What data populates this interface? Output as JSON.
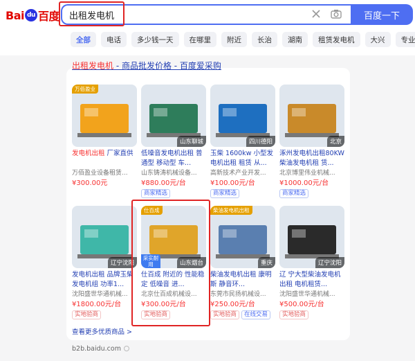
{
  "logo": {
    "bai": "Bai",
    "paw": "du",
    "du": "百度"
  },
  "search": {
    "query": "出租发电机",
    "button_label": "百度一下"
  },
  "chips": [
    "全部",
    "电话",
    "多少钱一天",
    "在哪里",
    "附近",
    "长治",
    "湖南",
    "租赁发电机",
    "大兴",
    "专业"
  ],
  "result": {
    "title_highlight": "出租发电机",
    "title_rest": " - 商品批发价格 - 百度爱采购",
    "more_label": "查看更多优质商品 >",
    "source": "b2b.baidu.com"
  },
  "products": [
    {
      "hl": "发电机出租",
      "rest": " 厂家直供",
      "shop": "万佰盈业设备租赁...",
      "price": "¥300.00元",
      "labels": [],
      "loc": "",
      "top_tag": "万佰盈业",
      "img_color": "#f2a31c"
    },
    {
      "hl": "",
      "rest": "低噪音发电机出租 普通型 移动型 车...",
      "shop": "山东铸涛机械设备...",
      "price": "¥880.00元/台",
      "labels": [
        {
          "t": "商家精选",
          "c": "blue"
        }
      ],
      "loc": "山东聊城",
      "top_tag": "",
      "img_color": "#2e7d5b"
    },
    {
      "hl": "",
      "rest": "玉柴 1600kw 小型发电机出租 租赁 从...",
      "shop": "高新技术产业开发...",
      "price": "¥100.00元/台",
      "labels": [
        {
          "t": "商家精选",
          "c": "blue"
        }
      ],
      "loc": "四川德阳",
      "top_tag": "",
      "img_color": "#1e6fc0"
    },
    {
      "hl": "",
      "rest": "涿州发电机出租80KW柴油发电机租 赁...",
      "shop": "北京博里伟业机械...",
      "price": "¥1000.00元/台",
      "labels": [
        {
          "t": "商家精选",
          "c": "blue"
        }
      ],
      "loc": "北京",
      "top_tag": "",
      "img_color": "#c98a2a"
    },
    {
      "hl": "",
      "rest": "发电机出租 品牌玉柴发电机组 功率1...",
      "shop": "沈阳盛世华通机械...",
      "price": "¥1800.00元/台",
      "labels": [
        {
          "t": "实地验商",
          "c": "red"
        }
      ],
      "loc": "辽宁沈阳",
      "top_tag": "",
      "img_color": "#3fb7a8"
    },
    {
      "hl": "",
      "rest": "仕百成 附近的 性能稳定 低噪音 进...",
      "shop": "北京仕百成机械设...",
      "price": "¥300.00元/台",
      "labels": [
        {
          "t": "实地验商",
          "c": "red"
        }
      ],
      "loc": "山东烟台",
      "top_tag": "仕百成",
      "badge": "采实耐用",
      "img_color": "#e0a52a"
    },
    {
      "hl": "",
      "rest": "柴油发电机出租 康明斯 静音环...",
      "shop": "东莞市民扬机械设...",
      "price": "¥250.00元/台",
      "labels": [
        {
          "t": "实地验商",
          "c": "red"
        },
        {
          "t": "在线交易",
          "c": "blue"
        }
      ],
      "loc": "重庆",
      "top_tag": "柴油发电机出租",
      "img_color": "#5a7fb0"
    },
    {
      "hl": "",
      "rest": "辽 宁大型柴油发电机出租 电机租赁...",
      "shop": "沈阳盛世华通机械...",
      "price": "¥500.00元/台",
      "labels": [
        {
          "t": "实地验商",
          "c": "red"
        }
      ],
      "loc": "辽宁沈阳",
      "top_tag": "",
      "img_color": "#2a2a2a"
    }
  ]
}
